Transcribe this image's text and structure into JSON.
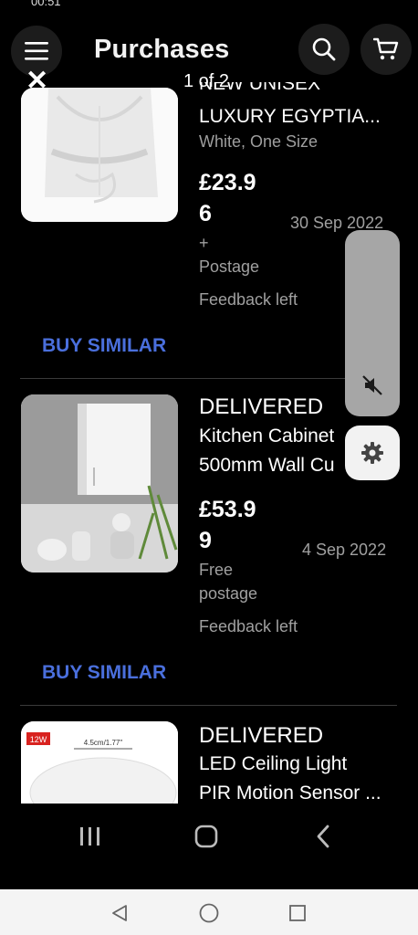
{
  "status_bar": {
    "time": "00:51"
  },
  "header": {
    "title": "Purchases",
    "menu_icon": "hamburger-menu-icon",
    "search_icon": "search-icon",
    "cart_icon": "cart-icon"
  },
  "viewer": {
    "close_label": "✕",
    "page_counter": "1 of 2"
  },
  "items": [
    {
      "status": "NEW UNISEX",
      "title_line1": "LUXURY EGYPTIA...",
      "variant": "White, One Size",
      "price_line1": "£23.9",
      "price_line2": "6",
      "date": "30 Sep 2022",
      "postage": "+ Postage",
      "feedback": "Feedback left",
      "action": "BUY SIMILAR"
    },
    {
      "status": "DELIVERED",
      "title_line1": "Kitchen Cabinet",
      "title_line2": "500mm Wall Cu",
      "price_line1": "£53.9",
      "price_line2": "9",
      "date": "4 Sep 2022",
      "postage": "Free postage",
      "feedback": "Feedback left",
      "action": "BUY SIMILAR"
    },
    {
      "status": "DELIVERED",
      "title_line1": "LED Ceiling Light",
      "title_line2": "PIR Motion Sensor ...",
      "thumb_badge": "12W",
      "thumb_dim": "4.5cm/1.77\""
    }
  ],
  "colors": {
    "accent_link": "#4a6fdc",
    "background": "#000000",
    "muted_text": "#a0a0a0"
  }
}
